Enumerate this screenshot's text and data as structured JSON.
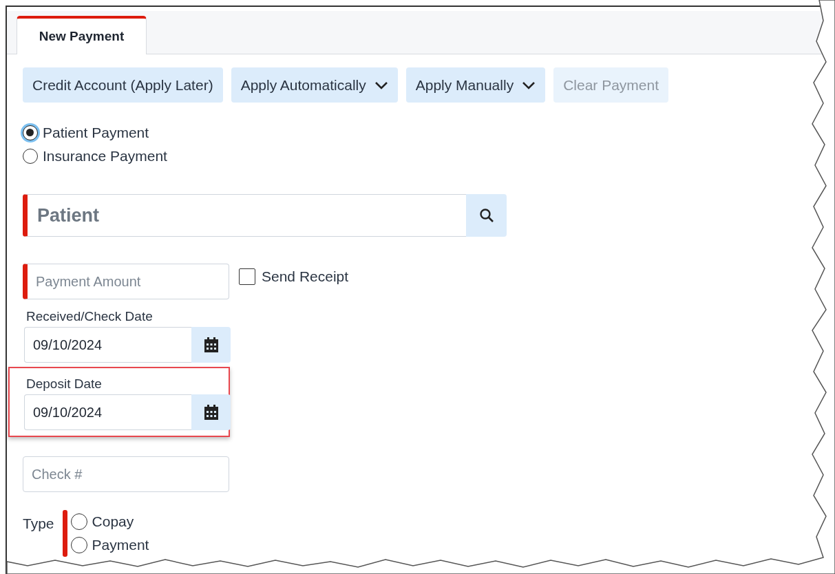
{
  "tabs": [
    {
      "label": "New Payment",
      "selected": true
    }
  ],
  "toolbar": [
    {
      "label": "Credit Account (Apply Later)",
      "kind": "plain",
      "disabled": false
    },
    {
      "label": "Apply Automatically",
      "kind": "dropdown",
      "disabled": false
    },
    {
      "label": "Apply Manually",
      "kind": "dropdown",
      "disabled": false
    },
    {
      "label": "Clear Payment",
      "kind": "plain",
      "disabled": true
    }
  ],
  "payment_source": [
    {
      "label": "Patient Payment",
      "selected": true
    },
    {
      "label": "Insurance Payment",
      "selected": false
    }
  ],
  "patient": {
    "placeholder": "Patient",
    "required": true
  },
  "payment_amount": {
    "placeholder": "Payment Amount",
    "required": true
  },
  "send_receipt": {
    "label": "Send Receipt",
    "checked": false
  },
  "dates": [
    {
      "label": "Received/Check Date",
      "value": "09/10/2024",
      "highlighted": false
    },
    {
      "label": "Deposit Date",
      "value": "09/10/2024",
      "highlighted": true
    }
  ],
  "check_number": {
    "placeholder": "Check #"
  },
  "type": {
    "label": "Type",
    "required": true,
    "options": [
      {
        "label": "Copay",
        "selected": false
      },
      {
        "label": "Payment",
        "selected": false
      }
    ]
  }
}
